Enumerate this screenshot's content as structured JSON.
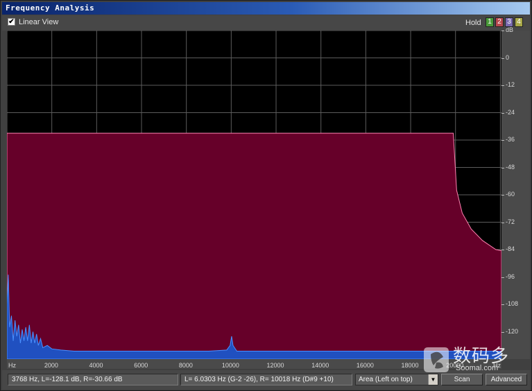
{
  "window": {
    "title": "Frequency Analysis"
  },
  "toolbar": {
    "linear_view_checked": true,
    "linear_view_label": "Linear View",
    "hold_label": "Hold",
    "hold_buttons": [
      {
        "label": "1",
        "color": "#4a9a3a"
      },
      {
        "label": "2",
        "color": "#b8484f"
      },
      {
        "label": "3",
        "color": "#7a6ab0"
      },
      {
        "label": "4",
        "color": "#a8a848"
      }
    ]
  },
  "chart_data": {
    "type": "area",
    "xlabel": "Hz",
    "ylabel": "dB",
    "x_ticks": [
      "Hz",
      "2000",
      "4000",
      "6000",
      "8000",
      "10000",
      "12000",
      "14000",
      "16000",
      "18000",
      "20000",
      "Hz"
    ],
    "y_ticks": [
      "dB",
      "0",
      "-12",
      "-24",
      "-36",
      "-48",
      "-60",
      "-72",
      "-84",
      "-96",
      "-108",
      "-120"
    ],
    "xlim": [
      0,
      22050
    ],
    "ylim": [
      -132,
      12
    ],
    "grid": true,
    "series": [
      {
        "fill": "#660029",
        "stroke": "#ff80b0",
        "points": [
          [
            0,
            -33
          ],
          [
            19900,
            -33
          ],
          [
            20050,
            -58
          ],
          [
            20300,
            -68
          ],
          [
            20700,
            -75
          ],
          [
            21200,
            -80
          ],
          [
            21800,
            -84
          ],
          [
            22050,
            -84.5
          ]
        ]
      },
      {
        "fill": "#2050c0",
        "stroke": "#4a90ff",
        "points": [
          [
            0,
            -108
          ],
          [
            60,
            -95
          ],
          [
            120,
            -118
          ],
          [
            200,
            -113
          ],
          [
            280,
            -124
          ],
          [
            360,
            -115
          ],
          [
            440,
            -122
          ],
          [
            520,
            -117
          ],
          [
            600,
            -125
          ],
          [
            680,
            -119
          ],
          [
            760,
            -124
          ],
          [
            840,
            -118
          ],
          [
            920,
            -124
          ],
          [
            1000,
            -117
          ],
          [
            1080,
            -125
          ],
          [
            1160,
            -120
          ],
          [
            1240,
            -125
          ],
          [
            1320,
            -121
          ],
          [
            1400,
            -126
          ],
          [
            1500,
            -123
          ],
          [
            1600,
            -127
          ],
          [
            1800,
            -126
          ],
          [
            2000,
            -127.5
          ],
          [
            2400,
            -128
          ],
          [
            3000,
            -128.5
          ],
          [
            4000,
            -128.5
          ],
          [
            5000,
            -128.5
          ],
          [
            6000,
            -128.5
          ],
          [
            7000,
            -128.5
          ],
          [
            8000,
            -128.5
          ],
          [
            9000,
            -128.5
          ],
          [
            9800,
            -128
          ],
          [
            9950,
            -126
          ],
          [
            10018,
            -122
          ],
          [
            10080,
            -126
          ],
          [
            10250,
            -128.5
          ],
          [
            11000,
            -128.5
          ],
          [
            13000,
            -128.5
          ],
          [
            15000,
            -128.5
          ],
          [
            17000,
            -128.5
          ],
          [
            19000,
            -128.5
          ],
          [
            20000,
            -128.5
          ],
          [
            22050,
            -128.5
          ]
        ]
      }
    ]
  },
  "status": {
    "cursor_readout": "3768 Hz, L=-128.1 dB, R=-30.66 dB",
    "peak_readout": "L= 6.0303 Hz (G-2 -26), R=  10018 Hz (D#9 +10)",
    "display_mode": "Area (Left on top)",
    "scan_label": "Scan",
    "advanced_label": "Advanced"
  },
  "watermark": {
    "chinese": "数码多",
    "english": "Soomal.com"
  }
}
